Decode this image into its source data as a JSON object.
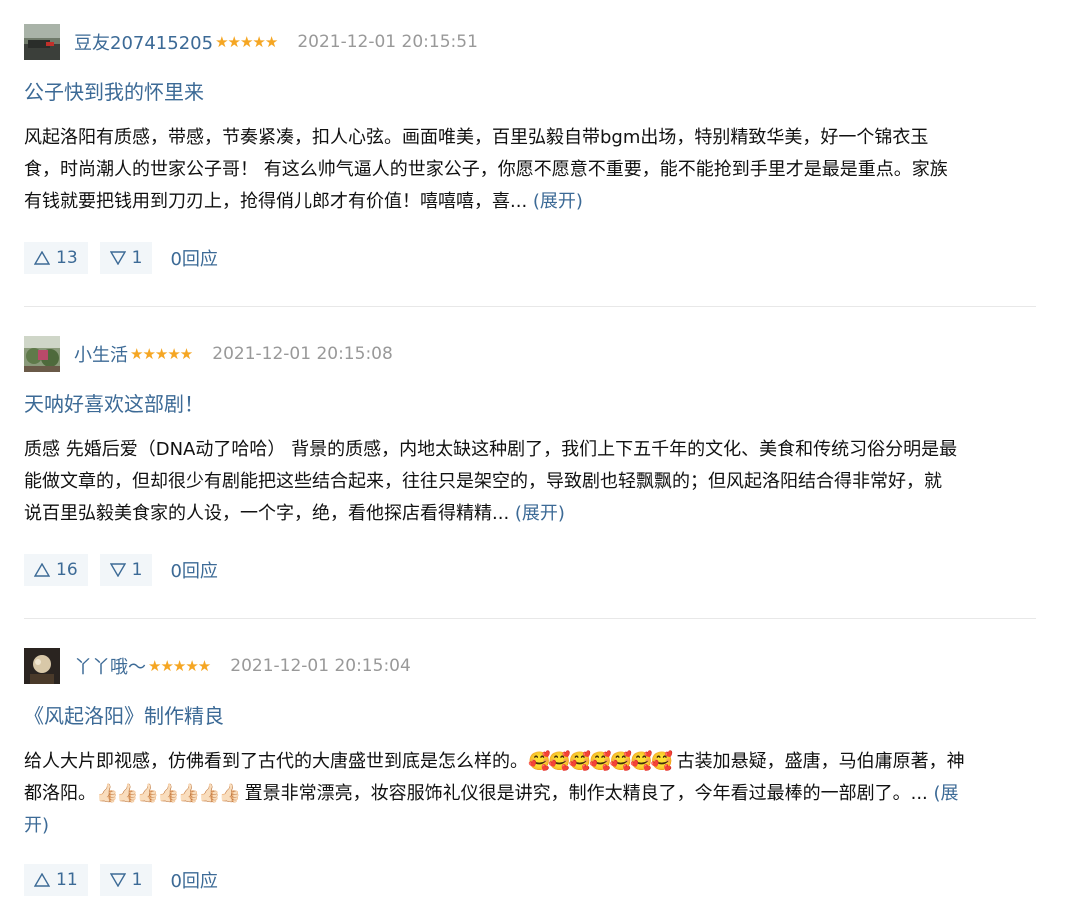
{
  "reviews": [
    {
      "username": "豆友207415205",
      "stars": "★★★★★",
      "time": "2021-12-01 20:15:51",
      "title": "公子快到我的怀里来",
      "body_lines": [
        "风起洛阳有质感，带感，节奏紧凑，扣人心弦。画面唯美，百里弘毅自带bgm出场，特别精致华美，好一个锦衣玉",
        "食，时尚潮人的世家公子哥！ 有这么帅气逼人的世家公子，你愿不愿意不重要，能不能抢到手里才是最是重点。家族",
        "有钱就要把钱用到刀刃上，抢得俏儿郎才有价值！嘻嘻嘻，喜... "
      ],
      "expand_label": "(展开)",
      "upvotes": "13",
      "downvotes": "1",
      "replies": "0回应"
    },
    {
      "username": "小生活",
      "stars": "★★★★★",
      "time": "2021-12-01 20:15:08",
      "title": "天呐好喜欢这部剧！",
      "body_lines": [
        "质感 先婚后爱（DNA动了哈哈） 背景的质感，内地太缺这种剧了，我们上下五千年的文化、美食和传统习俗分明是最",
        "能做文章的，但却很少有剧能把这些结合起来，往往只是架空的，导致剧也轻飘飘的；但风起洛阳结合得非常好，就",
        "说百里弘毅美食家的人设，一个字，绝，看他探店看得精精... "
      ],
      "expand_label": "(展开)",
      "upvotes": "16",
      "downvotes": "1",
      "replies": "0回应"
    },
    {
      "username": "丫丫哦～",
      "stars": "★★★★★",
      "time": "2021-12-01 20:15:04",
      "title": "《风起洛阳》制作精良",
      "line1_a": "给人大片即视感，仿佛看到了古代的大唐盛世到底是怎么样的。",
      "line1_emojis": "🥰🥰🥰🥰🥰🥰🥰",
      "line1_b": " 古装加悬疑，盛唐，马伯庸原著，神",
      "line2_a": "都洛阳。",
      "line2_thumbs": "👍🏻👍🏻👍🏻👍🏻👍🏻👍🏻👍🏻",
      "line2_b": " 置景非常漂亮，妆容服饰礼仪很是讲究，制作太精良了，今年看过最棒的一部剧了。... ",
      "expand_a": "(展",
      "expand_b": "开)",
      "upvotes": "11",
      "downvotes": "1",
      "replies": "0回应"
    }
  ],
  "icons": {
    "upvote": "triangle-up-icon",
    "downvote": "triangle-down-icon"
  },
  "colors": {
    "link": "#3c6a96",
    "star": "#f5a623",
    "time": "#999999",
    "vote_bg": "#f2f6f9"
  }
}
